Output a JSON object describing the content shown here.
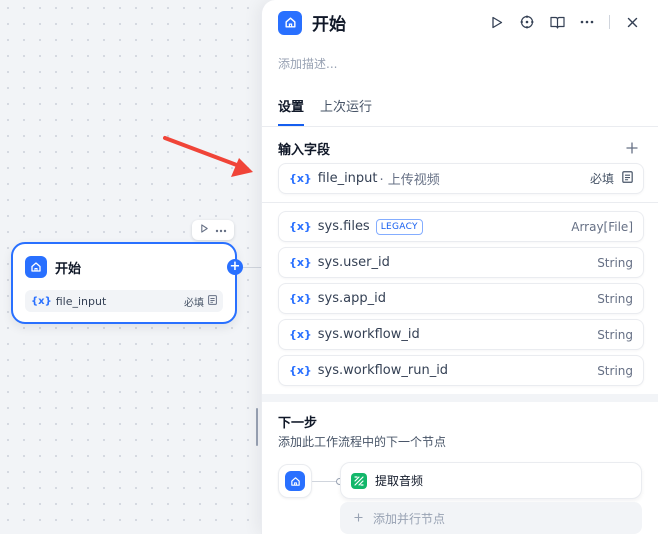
{
  "node": {
    "title": "开始",
    "field_name": "file_input",
    "field_required": "必填"
  },
  "panel": {
    "title": "开始",
    "description_placeholder": "添加描述...",
    "tabs": [
      {
        "label": "设置",
        "active": true
      },
      {
        "label": "上次运行",
        "active": false
      }
    ],
    "input_section_title": "输入字段",
    "input_field": {
      "name": "file_input",
      "sub": "· 上传视频",
      "required": "必填"
    },
    "system_vars": [
      {
        "name": "sys.files",
        "badge": "LEGACY",
        "type": "Array[File]"
      },
      {
        "name": "sys.user_id",
        "type": "String"
      },
      {
        "name": "sys.app_id",
        "type": "String"
      },
      {
        "name": "sys.workflow_id",
        "type": "String"
      },
      {
        "name": "sys.workflow_run_id",
        "type": "String"
      }
    ],
    "next_step": {
      "title": "下一步",
      "description": "添加此工作流程中的下一个节点",
      "next_node": "提取音频",
      "add_parallel": "添加并行节点"
    }
  },
  "var_symbol": "{x}",
  "colors": {
    "accent": "#2970ff",
    "arrow": "#f04438",
    "task": "#12b76a"
  }
}
